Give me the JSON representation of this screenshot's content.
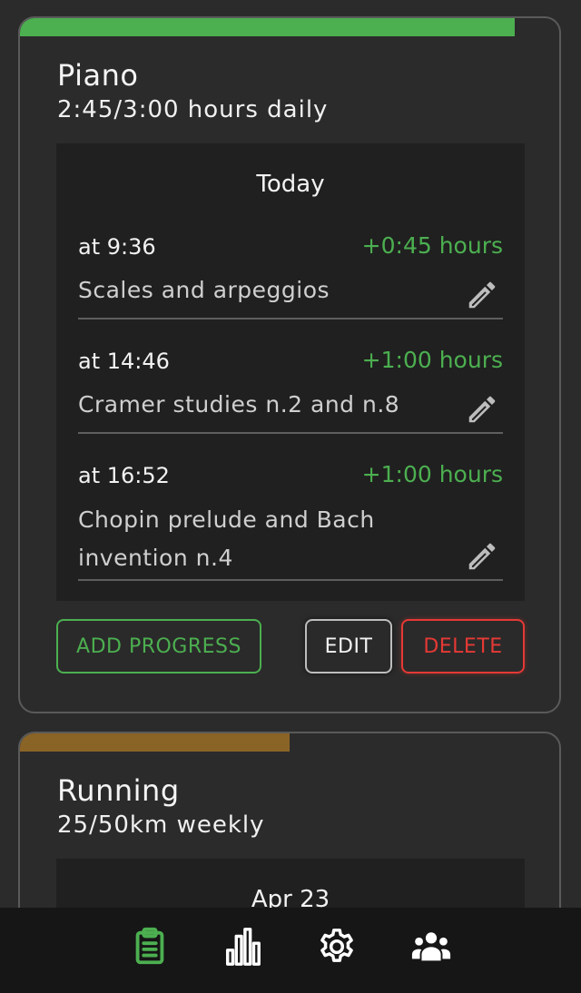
{
  "goals": [
    {
      "title": "Piano",
      "subtitle": "2:45/3:00 hours daily",
      "progress": 0.9167,
      "bar_color": "#4caf50",
      "log_header": "Today",
      "entries": [
        {
          "time": "at 9:36",
          "amount": "+0:45 hours",
          "note": "Scales and arpeggios"
        },
        {
          "time": "at 14:46",
          "amount": "+1:00 hours",
          "note": "Cramer studies n.2 and n.8"
        },
        {
          "time": "at 16:52",
          "amount": "+1:00 hours",
          "note": "Chopin prelude and Bach invention n.4"
        }
      ],
      "buttons": {
        "add": "ADD PROGRESS",
        "edit": "EDIT",
        "delete": "DELETE"
      }
    },
    {
      "title": "Running",
      "subtitle": "25/50km weekly",
      "progress": 0.5,
      "bar_color": "#8a6426",
      "log_header": "Apr 23"
    }
  ],
  "nav": {
    "items": [
      {
        "icon": "clipboard-list-icon",
        "active": true
      },
      {
        "icon": "bar-chart-icon",
        "active": false
      },
      {
        "icon": "gear-icon",
        "active": false
      },
      {
        "icon": "users-icon",
        "active": false
      }
    ],
    "active_color": "#4caf50",
    "inactive_color": "#ffffff"
  },
  "colors": {
    "background": "#2b2b2b",
    "panel": "#202020",
    "accent_green": "#4caf50",
    "danger_red": "#e53935"
  }
}
